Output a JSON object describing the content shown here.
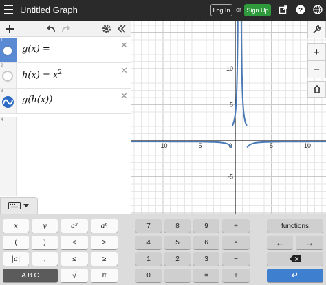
{
  "header": {
    "title": "Untitled Graph",
    "login_label": "Log In",
    "or_label": "or",
    "signup_label": "Sign Up"
  },
  "expressions": [
    {
      "num": "1",
      "latex": "g(x) =",
      "active": true
    },
    {
      "num": "2",
      "latex": "h(x) = x",
      "sup": "2"
    },
    {
      "num": "3",
      "latex": "g(h(x))"
    },
    {
      "num": "4"
    }
  ],
  "graph": {
    "x_ticks": [
      "-10",
      "-5",
      "0",
      "5",
      "10"
    ],
    "y_ticks": [
      "10",
      "5",
      "-5"
    ],
    "curve_color": "#4a7ab6"
  },
  "zoom": {
    "plus": "+",
    "minus": "−"
  },
  "keypad": {
    "row1": [
      "x",
      "y",
      "a²",
      "aᵇ",
      "7",
      "8",
      "9",
      "÷",
      "functions"
    ],
    "row2": [
      "(",
      ")",
      "<",
      ">",
      "4",
      "5",
      "6",
      "×",
      "←",
      "→"
    ],
    "row3": [
      "|a|",
      ",",
      "≤",
      "≥",
      "1",
      "2",
      "3",
      "−",
      "⌫"
    ],
    "row4": [
      "A B C",
      "√",
      "π",
      "0",
      ".",
      "=",
      "+",
      "↵"
    ]
  },
  "icons": [
    "menu-icon",
    "share-icon",
    "help-icon",
    "globe-icon",
    "add-icon",
    "undo-icon",
    "redo-icon",
    "settings-icon",
    "collapse-icon",
    "wrench-icon",
    "keyboard-icon",
    "home-icon"
  ]
}
